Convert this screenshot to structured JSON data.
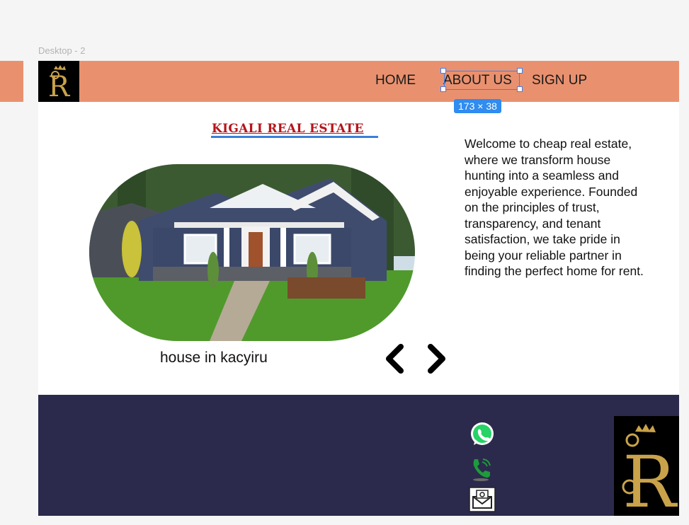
{
  "canvas": {
    "frame_label": "Desktop - 2"
  },
  "nav": {
    "links": [
      "HOME",
      "ABOUT US",
      "SIGN UP"
    ],
    "selection_size": "173 × 38",
    "logo_letter": "R"
  },
  "main": {
    "title": "KIGALI REAL ESTATE",
    "image_caption": "house in kacyiru",
    "about_text": "Welcome to cheap real estate, where we transform house hunting into a seamless and enjoyable experience. Founded on the principles of trust, transparency, and tenant satisfaction, we take pride in being your reliable partner in finding the perfect home for rent."
  },
  "footer": {
    "icons": [
      "whatsapp-icon",
      "phone-icon",
      "email-icon"
    ],
    "logo_letter": "R"
  },
  "colors": {
    "nav_bg": "#e9916f",
    "footer_bg": "#2b2a4c",
    "title": "#b5151b",
    "selection": "#3b82f6",
    "logo_gold": "#c9a24a"
  }
}
